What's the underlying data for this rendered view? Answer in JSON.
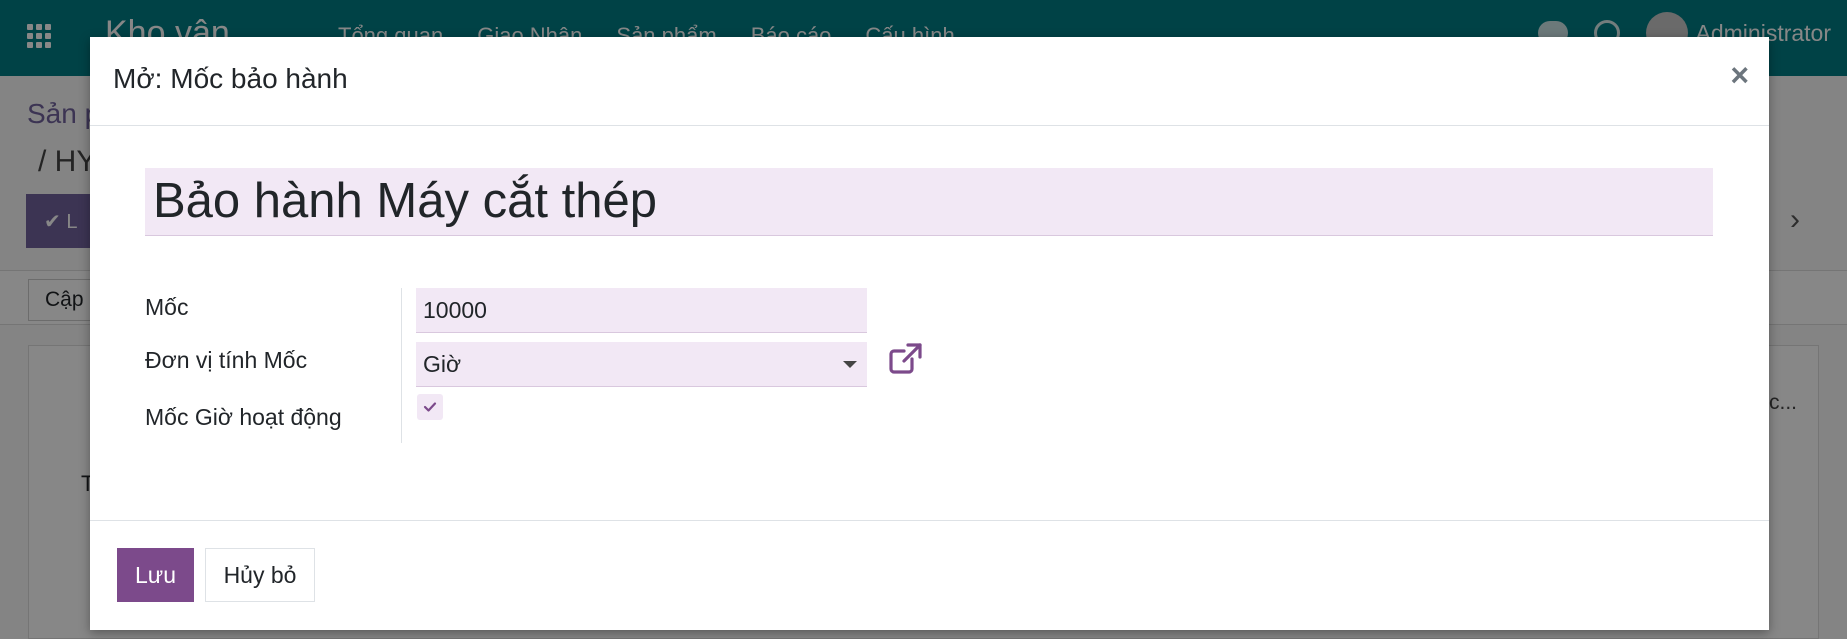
{
  "navbar": {
    "brand": "Kho vận",
    "menu": [
      "Tổng quan",
      "Giao Nhận",
      "Sản phẩm",
      "Báo cáo",
      "Cấu hình"
    ],
    "user": "Administrator"
  },
  "background": {
    "breadcrumb": "Sản p",
    "record": "/ HY",
    "save": "L",
    "update": "Cập",
    "column_hint": "c...",
    "sheet_text": "T"
  },
  "modal": {
    "title": "Mở: Mốc bảo hành",
    "name_value": "Bảo hành Máy cắt thép",
    "fields": {
      "moc_label": "Mốc",
      "moc_value": "10000",
      "unit_label": "Đơn vị tính Mốc",
      "unit_value": "Giờ",
      "active_label": "Mốc Giờ hoạt động",
      "active_checked": true
    },
    "footer": {
      "save_label": "Lưu",
      "cancel_label": "Hủy bỏ"
    }
  },
  "colors": {
    "primary": "#7c4a8b",
    "navbar": "#017e84",
    "field_bg": "#f2e8f5"
  },
  "icons": {
    "apps": "grid-icon",
    "close": "close-icon",
    "external": "external-link-icon",
    "check": "check-icon",
    "dropdown": "caret-down-icon"
  }
}
